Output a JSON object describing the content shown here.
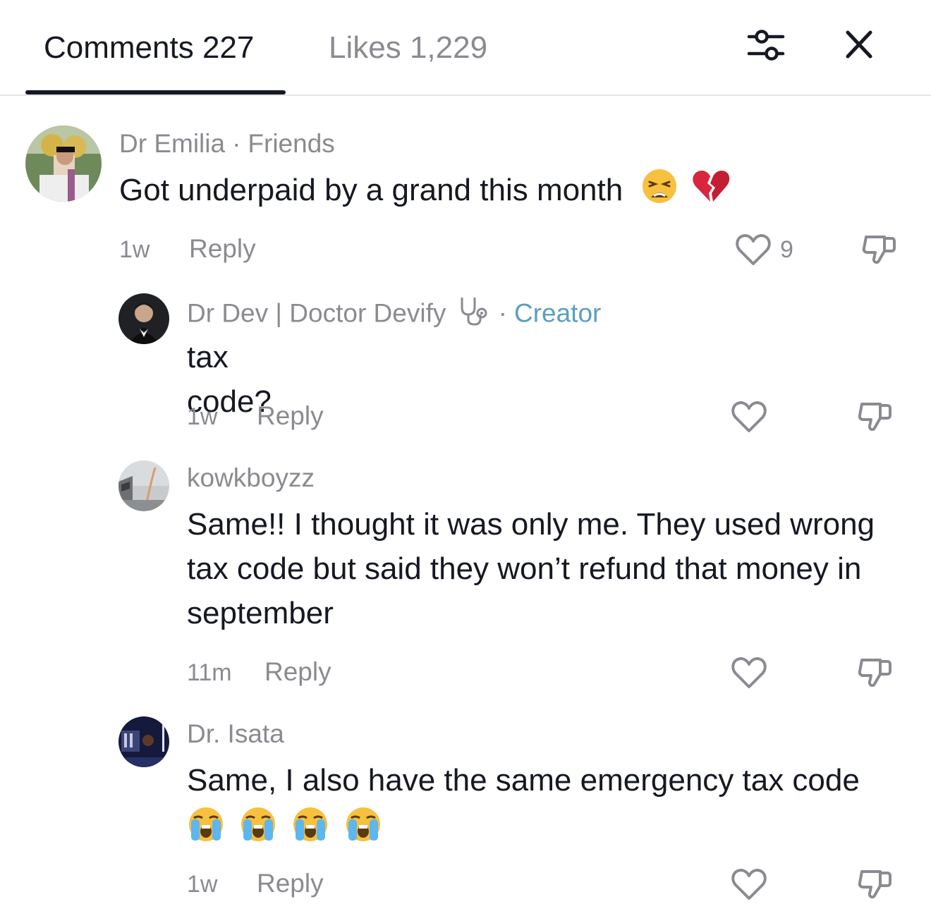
{
  "tabs": {
    "comments_label": "Comments 227",
    "likes_label": "Likes 1,229"
  },
  "header_icons": [
    "filter-sliders-icon",
    "close-icon"
  ],
  "comments": [
    {
      "author": "Dr Emilia",
      "relation": "Friends",
      "text": "Got underpaid by a grand this month",
      "emojis": [
        "weary-face-emoji",
        "broken-heart-emoji"
      ],
      "time": "1w",
      "reply_label": "Reply",
      "like_count": "9",
      "avatar_color": "#8a9a6a"
    },
    {
      "author": "Dr Dev | Doctor Devify",
      "author_icon": "stethoscope-icon",
      "relation": "Creator",
      "text": "tax code?",
      "time": "1w",
      "reply_label": "Reply",
      "avatar_color": "#2b2b2e"
    },
    {
      "author": "kowkboyzz",
      "text": "Same!! I thought it was only me. They used wrong tax code but said they won’t refund that money in september",
      "time": "11m",
      "reply_label": "Reply",
      "avatar_color": "#9a9c9e"
    },
    {
      "author": "Dr. Isata",
      "text": "Same, I also have the same emergency tax code",
      "emojis": [
        "loudly-crying-face-emoji",
        "loudly-crying-face-emoji",
        "loudly-crying-face-emoji",
        "loudly-crying-face-emoji"
      ],
      "time": "1w",
      "reply_label": "Reply",
      "avatar_color": "#1d2550"
    }
  ],
  "colors": {
    "primary_text": "#161823",
    "secondary_text": "#8a8b91",
    "creator_accent": "#5c9ec2",
    "divider": "#e6e6e8"
  }
}
